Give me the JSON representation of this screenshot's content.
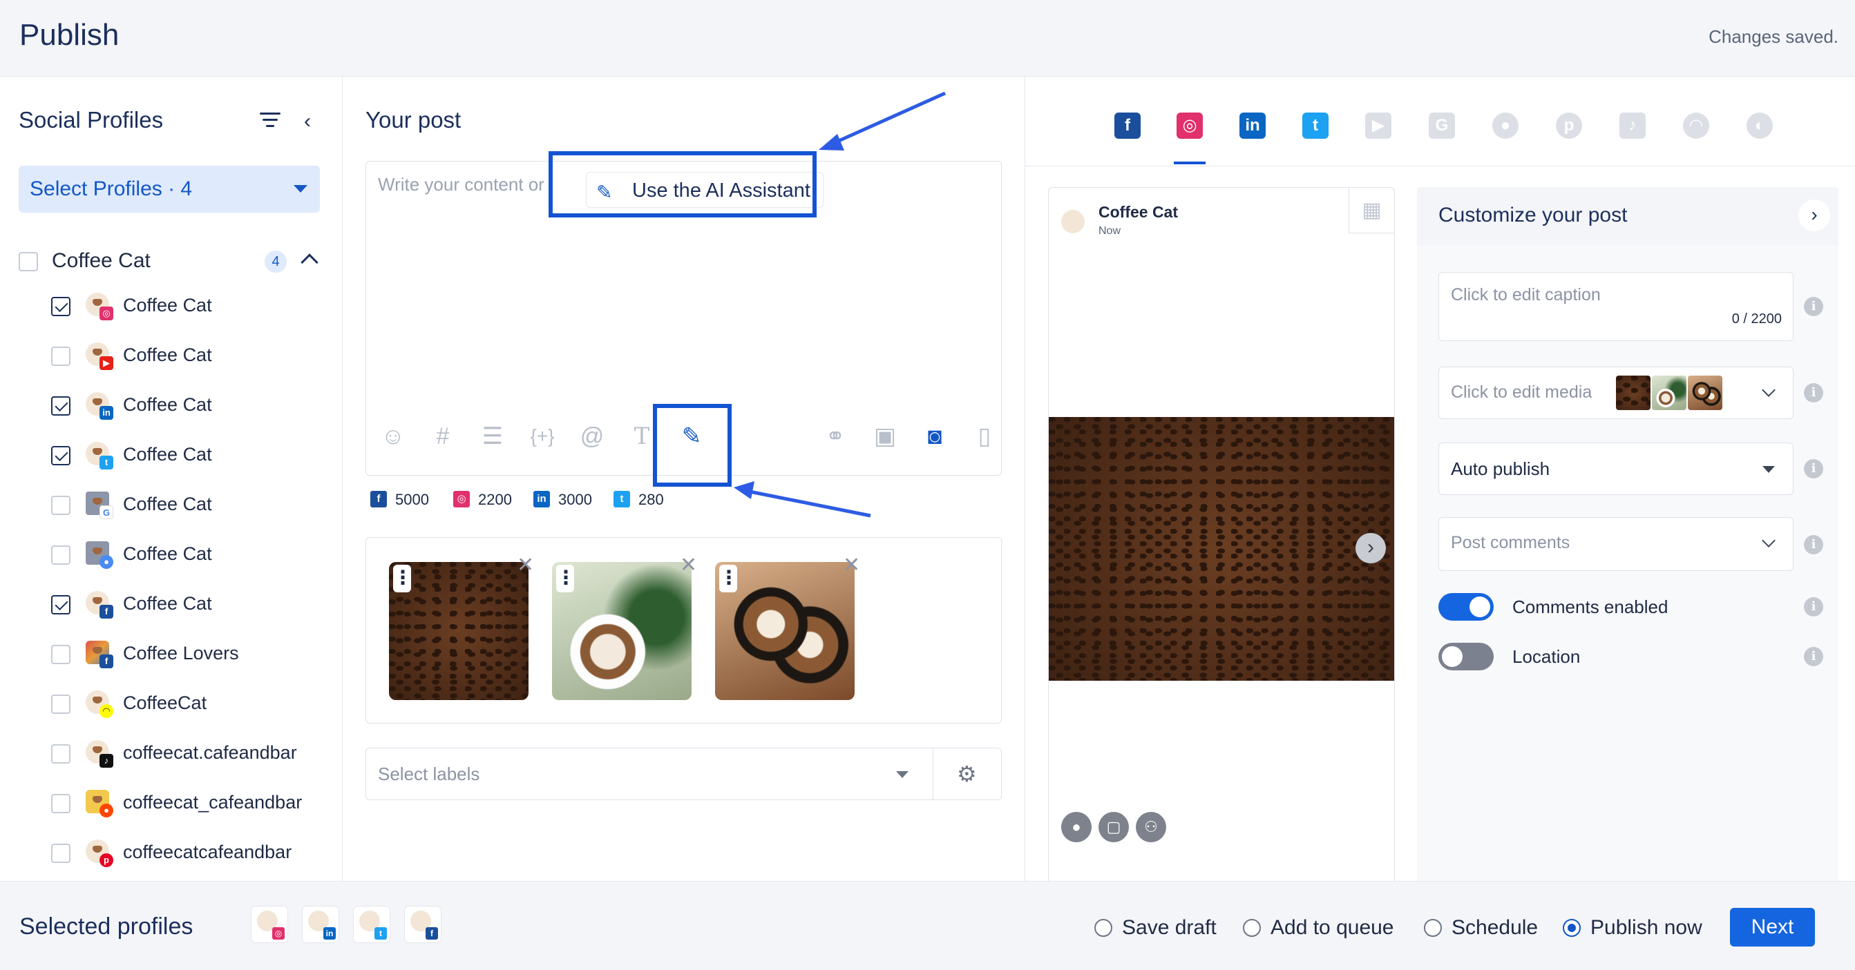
{
  "header": {
    "title": "Publish",
    "status": "Changes saved."
  },
  "left": {
    "title": "Social Profiles",
    "select_button": "Select Profiles · 4",
    "group": {
      "name": "Coffee Cat",
      "count": "4"
    },
    "profiles": [
      {
        "name": "Coffee Cat",
        "network": "instagram",
        "checked": true
      },
      {
        "name": "Coffee Cat",
        "network": "youtube",
        "checked": false
      },
      {
        "name": "Coffee Cat",
        "network": "linkedin",
        "checked": true
      },
      {
        "name": "Coffee Cat",
        "network": "twitter",
        "checked": true
      },
      {
        "name": "Coffee Cat",
        "network": "google",
        "checked": false
      },
      {
        "name": "Coffee Cat",
        "network": "google-business",
        "checked": false
      },
      {
        "name": "Coffee Cat",
        "network": "facebook",
        "checked": true
      },
      {
        "name": "Coffee Lovers",
        "network": "facebook-group",
        "checked": false
      },
      {
        "name": "CoffeeCat",
        "network": "snapchat",
        "checked": false
      },
      {
        "name": "coffeecat.cafeandbar",
        "network": "tiktok",
        "checked": false
      },
      {
        "name": "coffeecat_cafeandbar",
        "network": "reddit",
        "checked": false
      },
      {
        "name": "coffeecatcafeandbar",
        "network": "pinterest",
        "checked": false
      }
    ]
  },
  "middle": {
    "title": "Your post",
    "placeholder": "Write your content or",
    "ai_button": "Use the AI Assistant",
    "limits": {
      "facebook": "5000",
      "instagram": "2200",
      "linkedin": "3000",
      "twitter": "280"
    },
    "labels_placeholder": "Select labels"
  },
  "preview": {
    "name": "Coffee Cat",
    "time": "Now"
  },
  "customize": {
    "title": "Customize your post",
    "caption_placeholder": "Click to edit caption",
    "caption_count": "0 / 2200",
    "media_placeholder": "Click to edit media",
    "publish_mode": "Auto publish",
    "comments_placeholder": "Post comments",
    "toggle_comments": "Comments enabled",
    "toggle_location": "Location"
  },
  "footer": {
    "selected_title": "Selected profiles",
    "options": [
      "Save draft",
      "Add to queue",
      "Schedule",
      "Publish now"
    ],
    "selected_option": "Publish now",
    "next": "Next"
  },
  "colors": {
    "accent": "#1357c6",
    "highlight": "#1454d3",
    "facebook": "#1877f2",
    "instagram": "#e1306c",
    "linkedin": "#0a66c2",
    "twitter": "#1da1f2"
  }
}
